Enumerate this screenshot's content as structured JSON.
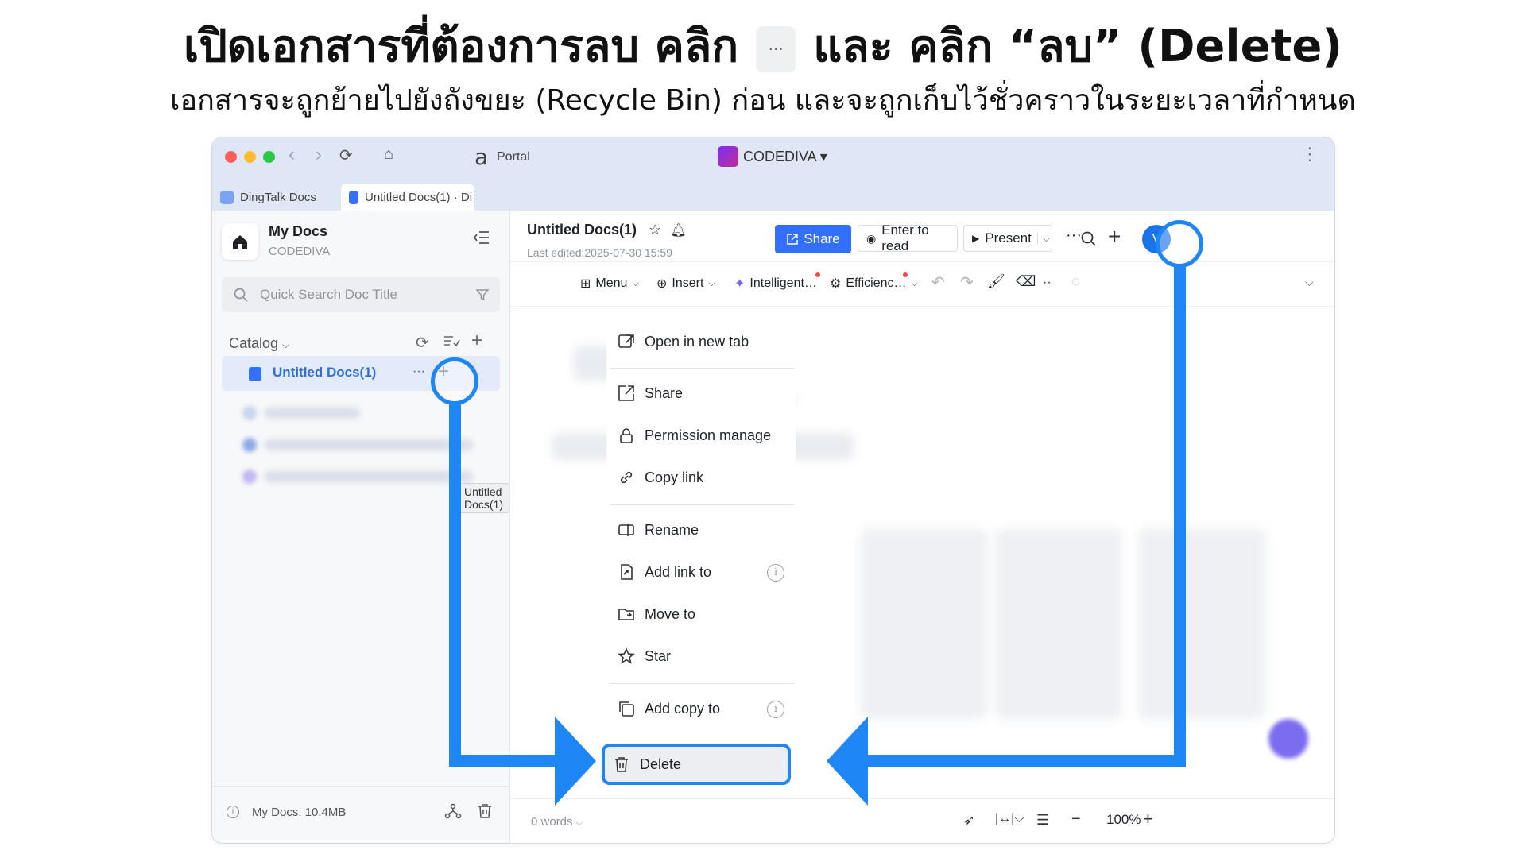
{
  "headline": {
    "part1": "เปิดเอกสารที่ต้องการลบ คลิก",
    "dots": "···",
    "part2": "และ คลิก “ลบ” (Delete)"
  },
  "subline": "เอกสารจะถูกย้ายไปยังถังขยะ (Recycle Bin) ก่อน และจะถูกเก็บไว้ชั่วคราวในระยะเวลาที่กำหนด",
  "titlebar": {
    "portal_label": "Portal",
    "brand": "CODEDIVA ▾"
  },
  "tabs": [
    {
      "label": "DingTalk Docs"
    },
    {
      "label": "Untitled Docs(1) · Di"
    }
  ],
  "sidebar": {
    "title": "My Docs",
    "subtitle": "CODEDIVA",
    "search_placeholder": "Quick Search Doc Title",
    "catalog_label": "Catalog",
    "doc_item": "Untitled Docs(1)",
    "tooltip": "Untitled Docs(1)",
    "storage": "My Docs: 10.4MB"
  },
  "doc": {
    "title": "Untitled Docs(1)",
    "last_edited": "Last edited:2025-07-30 15:59"
  },
  "header": {
    "share": "Share",
    "enter_read": "Enter to read",
    "present": "Present",
    "avatar": "V"
  },
  "toolbar": {
    "menu": "Menu",
    "insert": "Insert",
    "intelligent": "Intelligent…",
    "efficiency": "Efficienc…"
  },
  "status": {
    "words": "0 words",
    "zoom": "100%"
  },
  "context_menu": {
    "open_new_tab": "Open in new tab",
    "share": "Share",
    "permission": "Permission manage",
    "copy_link": "Copy link",
    "rename": "Rename",
    "add_link_to": "Add link to",
    "move_to": "Move to",
    "star": "Star",
    "add_copy_to": "Add copy to",
    "delete": "Delete"
  },
  "colors": {
    "accent": "#1f86f5",
    "brand_blue": "#3370ff",
    "titlebar": "#dfe6f5"
  }
}
